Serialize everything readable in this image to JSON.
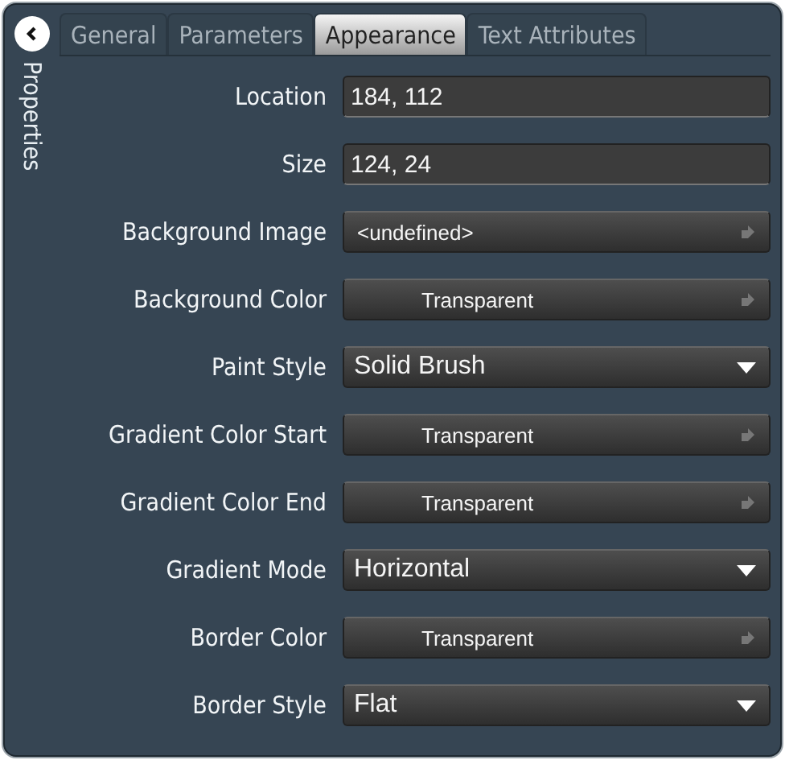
{
  "sidebar": {
    "title": "Properties"
  },
  "tabs": [
    {
      "label": "General",
      "selected": false
    },
    {
      "label": "Parameters",
      "selected": false
    },
    {
      "label": "Appearance",
      "selected": true
    },
    {
      "label": "Text Attributes",
      "selected": false
    }
  ],
  "properties": [
    {
      "label": "Location",
      "kind": "text",
      "value": "184, 112"
    },
    {
      "label": "Size",
      "kind": "text",
      "value": "124, 24"
    },
    {
      "label": "Background Image",
      "kind": "picker",
      "value": "<undefined>"
    },
    {
      "label": "Background Color",
      "kind": "color",
      "value": "Transparent"
    },
    {
      "label": "Paint Style",
      "kind": "dropdown",
      "value": "Solid Brush"
    },
    {
      "label": "Gradient Color Start",
      "kind": "color",
      "value": "Transparent"
    },
    {
      "label": "Gradient Color End",
      "kind": "color",
      "value": "Transparent"
    },
    {
      "label": "Gradient Mode",
      "kind": "dropdown",
      "value": "Horizontal"
    },
    {
      "label": "Border Color",
      "kind": "color",
      "value": "Transparent"
    },
    {
      "label": "Border Style",
      "kind": "dropdown",
      "value": "Flat"
    }
  ]
}
